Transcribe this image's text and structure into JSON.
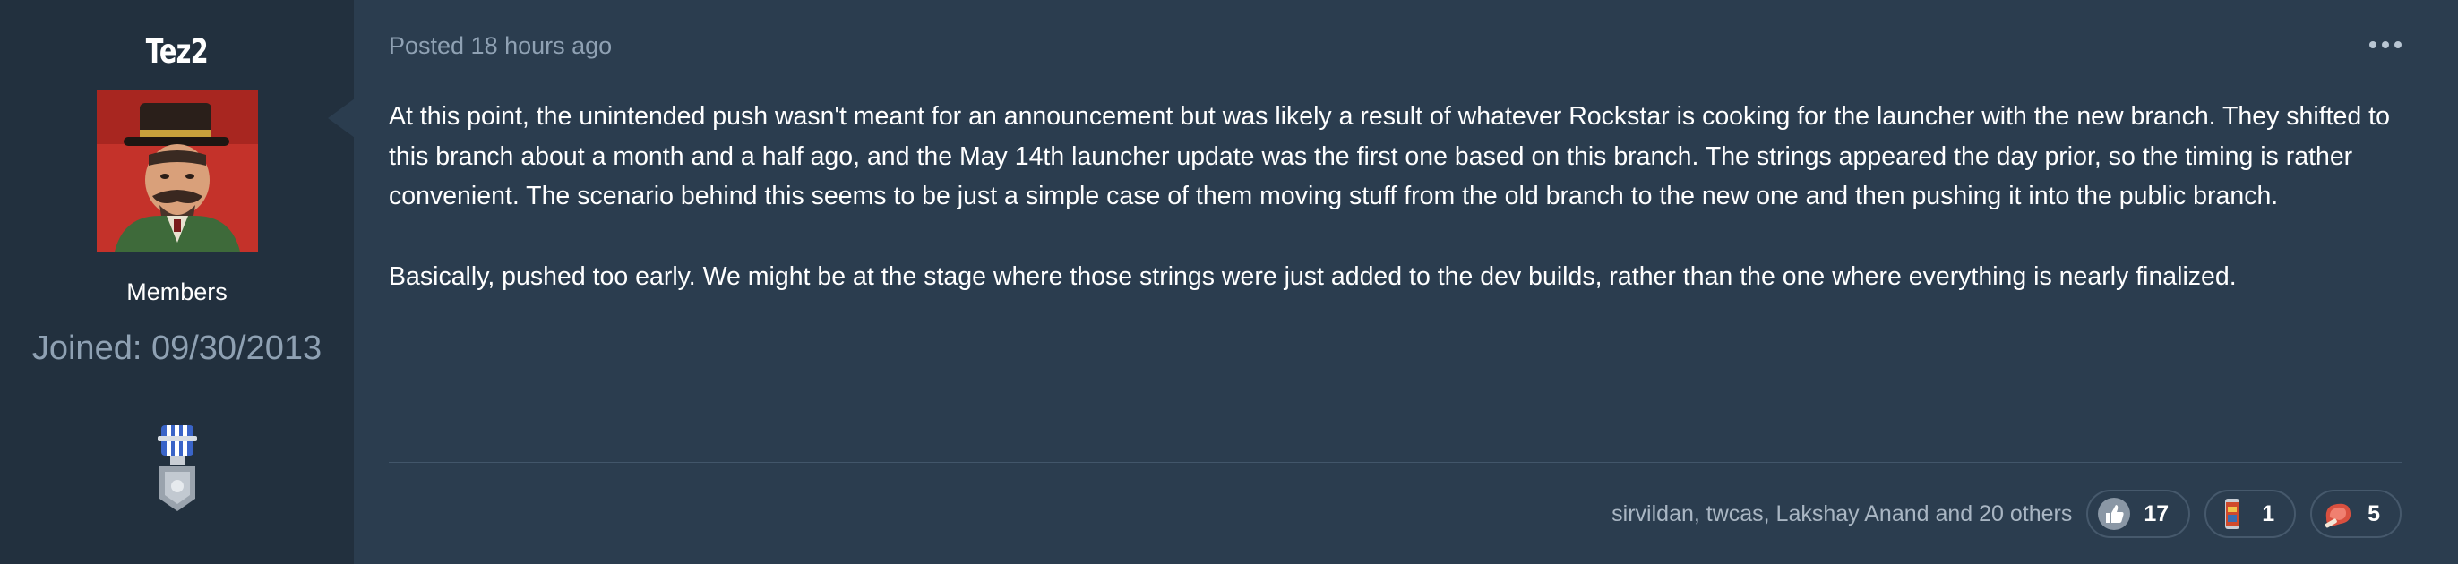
{
  "author": {
    "name": "Tez2",
    "group": "Members",
    "joined": "Joined: 09/30/2013"
  },
  "post": {
    "posted": "Posted 18 hours ago",
    "paragraphs": [
      "At this point, the unintended push wasn't meant for an announcement but was likely a result of whatever Rockstar is cooking for the launcher with the new branch. They shifted to this branch about a month and a half ago, and the May 14th launcher update was the first one based on this branch. The strings appeared the day prior, so the timing is rather convenient. The scenario behind this seems to be just a simple case of them moving stuff from the old branch to the new one and then pushing it into the public branch.",
      "Basically, pushed too early. We might be at the stage where those strings were just added to the dev builds, rather than the one where everything is nearly finalized."
    ]
  },
  "reactions": {
    "summary": "sirvildan, twcas, Lakshay Anand and 20 others",
    "items": [
      {
        "icon": "thumbs-up-icon",
        "count": "17"
      },
      {
        "icon": "soda-can-icon",
        "count": "1"
      },
      {
        "icon": "steak-icon",
        "count": "5"
      }
    ]
  },
  "colors": {
    "background": "#2b3d4f",
    "sidebar": "#22303e",
    "muted_text": "#8fa1b3"
  }
}
